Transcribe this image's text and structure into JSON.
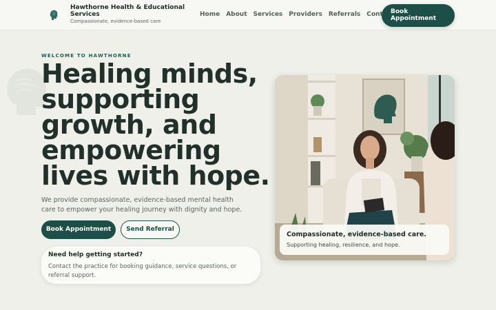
{
  "header": {
    "brand_name": "Hawthorne Health & Educational Services",
    "tagline": "Compassionate, evidence-based care",
    "logo_icon": "brain-head-icon",
    "nav": [
      {
        "label": "Home"
      },
      {
        "label": "About"
      },
      {
        "label": "Services"
      },
      {
        "label": "Providers"
      },
      {
        "label": "Referrals"
      },
      {
        "label": "Contact"
      }
    ],
    "book_button": "Book Appointment"
  },
  "hero": {
    "eyebrow": "WELCOME TO HAWTHORNE",
    "headline_lines": [
      "Healing minds,",
      "supporting",
      "growth, and",
      "empowering",
      "lives with hope."
    ],
    "subtitle": "We provide compassionate, evidence-based mental health care to empower your healing journey with dignity and hope.",
    "primary_button": "Book Appointment",
    "secondary_button": "Send Referral",
    "help_card": {
      "title": "Need help getting started?",
      "text": "Contact the practice for booking guidance, service questions, or referral support."
    },
    "image_caption": {
      "title": "Compassionate, evidence-based care.",
      "text": "Supporting healing, resilience, and hope."
    }
  },
  "colors": {
    "accent": "#1c4f47",
    "background": "#f0f0ea",
    "text": "#22302c"
  }
}
